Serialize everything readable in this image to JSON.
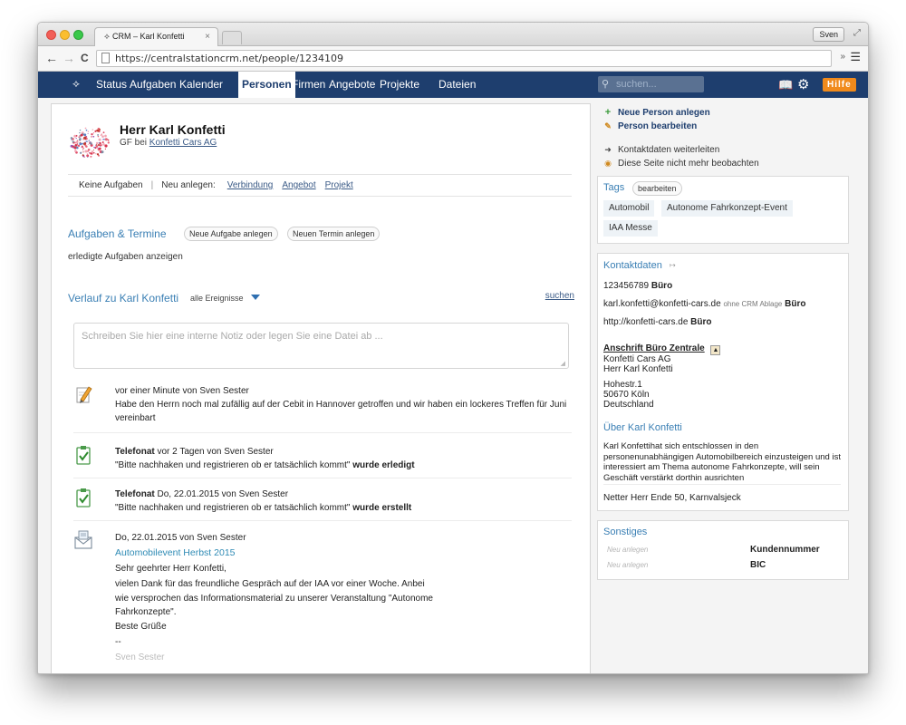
{
  "browser": {
    "tab_title": "CRM – Karl Konfetti",
    "tab_close": "×",
    "user": "Sven",
    "url": "https://centralstationcrm.net/people/1234109",
    "icons": {
      "back": "←",
      "forward": "→",
      "reload": "C",
      "extensions": "»",
      "menu": "☰",
      "expand": "⤢"
    }
  },
  "appnav": {
    "logo": "⟡",
    "items": [
      {
        "label": "Status",
        "active": false
      },
      {
        "label": "Aufgaben",
        "active": false
      },
      {
        "label": "Kalender",
        "active": false
      },
      {
        "label": "Personen",
        "active": true
      },
      {
        "label": "Firmen",
        "active": false
      },
      {
        "label": "Angebote",
        "active": false
      },
      {
        "label": "Projekte",
        "active": false
      },
      {
        "label": "Dateien",
        "active": false
      }
    ],
    "search_placeholder": "suchen...",
    "help_label": "Hilfe",
    "colors": {
      "bar": "#1e3e6e",
      "help": "#f08a1c"
    }
  },
  "person": {
    "name": "Herr Karl Konfetti",
    "role_prefix": "GF bei",
    "company": "Konfetti Cars AG"
  },
  "actions": {
    "no_tasks": "Keine Aufgaben",
    "separator": "|",
    "new_label": "Neu anlegen:",
    "links": [
      "Verbindung",
      "Angebot",
      "Projekt"
    ]
  },
  "tasks": {
    "title": "Aufgaben & Termine",
    "new_task": "Neue Aufgabe anlegen",
    "new_event": "Neuen Termin anlegen",
    "show_done": "erledigte Aufgaben anzeigen"
  },
  "history": {
    "title": "Verlauf zu Karl Konfetti",
    "filter": "alle Ereignisse",
    "search": "suchen",
    "note_placeholder": "Schreiben Sie hier eine interne Notiz oder legen Sie eine Datei ab ...",
    "events": [
      {
        "icon": "pencil-icon",
        "meta": "vor einer Minute von Sven Sester",
        "text": "Habe den Herrn noch mal zufällig auf der Cebit in Hannover getroffen und wir haben ein lockeres Treffen für Juni vereinbart"
      },
      {
        "icon": "checklist-icon",
        "type": "Telefonat",
        "meta": "vor 2 Tagen von Sven Sester",
        "quote": "\"Bitte nachhaken und registrieren ob er tatsächlich kommt\"",
        "status": "wurde erledigt"
      },
      {
        "icon": "checklist-icon",
        "type": "Telefonat",
        "meta": "Do, 22.01.2015 von Sven Sester",
        "quote": "\"Bitte nachhaken und registrieren ob er tatsächlich kommt\"",
        "status": "wurde erstellt"
      },
      {
        "icon": "envelope-icon",
        "meta": "Do, 22.01.2015 von Sven Sester",
        "subject": "Automobilevent Herbst 2015",
        "lines": [
          "Sehr geehrter Herr Konfetti,",
          "vielen Dank für das freundliche Gespräch auf der IAA vor einer Woche. Anbei",
          "wie versprochen das Informationsmaterial zu unserer Veranstaltung \"Autonome",
          "Fahrkonzepte\".",
          "Beste Grüße",
          "--",
          "Sven Sester"
        ]
      }
    ]
  },
  "sidebar": {
    "links": [
      {
        "label": "Neue Person anlegen",
        "icon": "plus-icon",
        "strong": true
      },
      {
        "label": "Person bearbeiten",
        "icon": "pencil-icon",
        "strong": true
      },
      {
        "label": "Kontaktdaten weiterleiten",
        "icon": "forward-icon",
        "strong": false
      },
      {
        "label": "Diese Seite nicht mehr beobachten",
        "icon": "eye-icon",
        "strong": false
      }
    ],
    "tags": {
      "title": "Tags",
      "edit": "bearbeiten",
      "items": [
        "Automobil",
        "Autonome Fahrkonzept-Event",
        "IAA Messe"
      ]
    },
    "contact": {
      "title": "Kontaktdaten",
      "phone": "123456789",
      "phone_type": "Büro",
      "email": "karl.konfetti@konfetti-cars.de",
      "email_note": "ohne CRM Ablage",
      "email_type": "Büro",
      "web": "http://konfetti-cars.de",
      "web_type": "Büro",
      "address_title": "Anschrift Büro Zentrale",
      "address_lines_1": [
        "Konfetti Cars AG",
        "Herr Karl Konfetti"
      ],
      "address_lines_2": [
        "Hohestr.1",
        "50670 Köln",
        "Deutschland"
      ]
    },
    "about": {
      "title": "Über Karl Konfetti",
      "text": "Karl Konfettihat sich entschlossen in den personenunabhängigen Automobilbereich einzusteigen und ist interessiert am Thema autonome Fahrkonzepte, will sein Geschäft verstärkt dorthin ausrichten",
      "extra": "Netter Herr Ende 50, Karnvalsjeck"
    },
    "misc": {
      "title": "Sonstiges",
      "rows": [
        {
          "hint": "Neu anlegen",
          "label": "Kundennummer"
        },
        {
          "hint": "Neu anlegen",
          "label": "BIC"
        }
      ]
    }
  }
}
